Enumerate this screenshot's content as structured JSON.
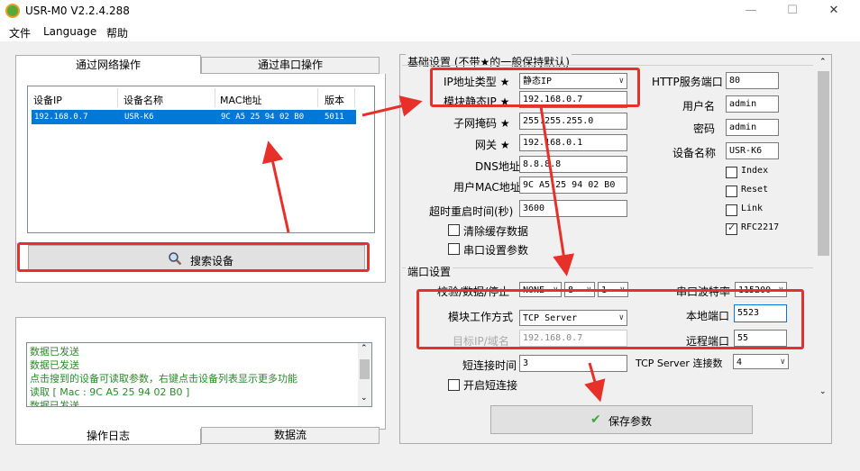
{
  "window": {
    "title": "USR-M0 V2.2.4.288",
    "minimize": "—",
    "maximize": "☐",
    "close": "✕"
  },
  "menu": [
    "文件",
    "Language",
    "帮助"
  ],
  "left": {
    "tabs": [
      "通过网络操作",
      "通过串口操作"
    ],
    "table": {
      "headers": [
        "设备IP",
        "设备名称",
        "MAC地址",
        "版本"
      ],
      "rows": [
        [
          "192.168.0.7",
          "USR-K6",
          "9C A5 25 94 02 B0",
          "5011"
        ]
      ]
    },
    "search_button": "搜索设备",
    "log": [
      "数据已发送",
      "数据已发送",
      "点击搜到的设备可读取参数，右键点击设备列表显示更多功能",
      "读取 [ Mac : 9C A5 25 94 02 B0 ]",
      "数据已发送"
    ],
    "bottom_tabs": [
      "操作日志",
      "数据流"
    ]
  },
  "basic": {
    "legend": "基础设置 (不带★的一般保持默认)",
    "ip_type_label": "IP地址类型 ★",
    "ip_type_value": "静态IP",
    "static_ip_label": "模块静态IP ★",
    "static_ip_value": "192.168.0.7",
    "mask_label": "子网掩码 ★",
    "mask_value": "255.255.255.0",
    "gateway_label": "网关 ★",
    "gateway_value": "192.168.0.1",
    "dns_label": "DNS地址",
    "dns_value": "8.8.8.8",
    "mac_label": "用户MAC地址",
    "mac_value": "9C A5 25 94 02 B0",
    "timeout_label": "超时重启时间(秒)",
    "timeout_value": "3600",
    "clear_cache": "清除缓存数据",
    "serial_param": "串口设置参数",
    "http_port_label": "HTTP服务端口",
    "http_port_value": "80",
    "username_label": "用户名",
    "username_value": "admin",
    "password_label": "密码",
    "password_value": "admin",
    "devname_label": "设备名称",
    "devname_value": "USR-K6",
    "cb_index": "Index",
    "cb_reset": "Reset",
    "cb_link": "Link",
    "cb_rfc": "RFC2217"
  },
  "serial": {
    "legend": "端口设置",
    "parity_label": "校验/数据/停止",
    "parity_value": "NONE",
    "data_value": "8",
    "stop_value": "1",
    "baud_label": "串口波特率",
    "baud_value": "115200",
    "mode_label": "模块工作方式",
    "mode_value": "TCP Server",
    "local_port_label": "本地端口",
    "local_port_value": "5523",
    "target_label": "目标IP/域名",
    "target_value": "192.168.0.7",
    "remote_port_label": "远程端口",
    "remote_port_value": "55",
    "short_label": "短连接时间",
    "short_value": "3",
    "tcp_conn_label": "TCP Server 连接数",
    "tcp_conn_value": "4",
    "enable_short": "开启短连接"
  },
  "save_button": "保存参数",
  "colors": {
    "annotation": "#e8302a",
    "selection": "#0078d7",
    "log_text": "#2a8a2a",
    "save_check": "#3aa83a"
  }
}
